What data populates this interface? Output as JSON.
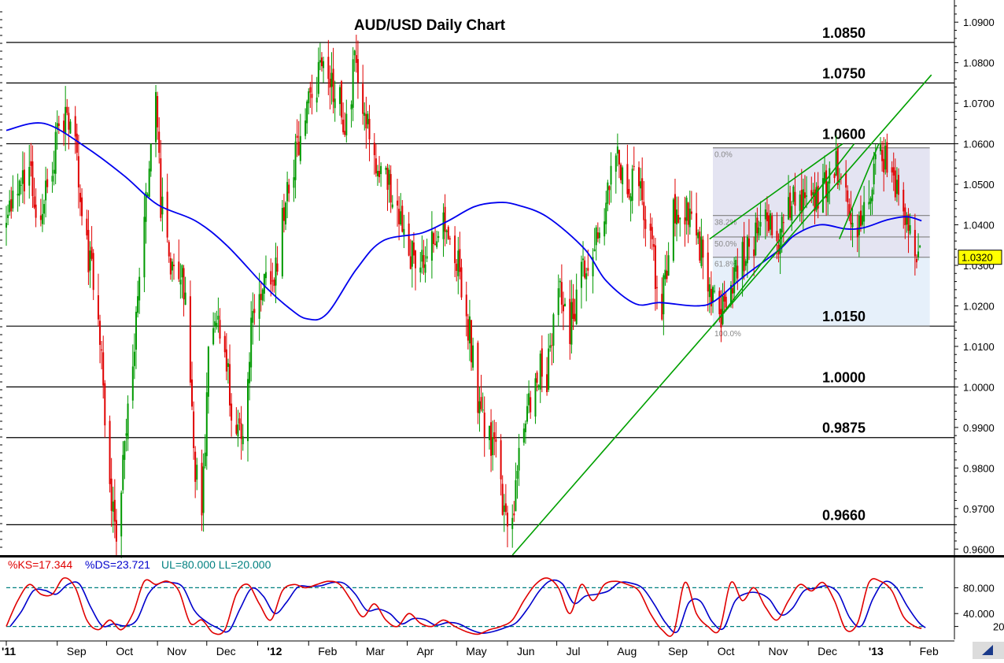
{
  "chart_data": {
    "type": "candlestick",
    "title": "AUD/USD Daily Chart",
    "instrument": "AUD/USD",
    "timeframe": "Daily",
    "price_axis": {
      "ylim": [
        0.9585,
        1.0945
      ],
      "ticks": [
        "0.9600",
        "0.9700",
        "0.9800",
        "0.9900",
        "1.0000",
        "1.0100",
        "1.0200",
        "1.0300",
        "1.0400",
        "1.0500",
        "1.0600",
        "1.0700",
        "1.0800",
        "1.0900"
      ],
      "current_price_label": "1.0320"
    },
    "x_axis": {
      "labels": [
        "'11",
        "Sep",
        "Oct",
        "Nov",
        "Dec",
        "'12",
        "Feb",
        "Mar",
        "Apr",
        "May",
        "Jun",
        "Jul",
        "Aug",
        "Sep",
        "Oct",
        "Nov",
        "Dec",
        "'13",
        "Feb"
      ],
      "range": [
        "2011-08-01",
        "2013-02-08"
      ]
    },
    "horizontal_levels": [
      {
        "value": 1.085,
        "label": "1.0850"
      },
      {
        "value": 1.075,
        "label": "1.0750"
      },
      {
        "value": 1.06,
        "label": "1.0600"
      },
      {
        "value": 1.015,
        "label": "1.0150"
      },
      {
        "value": 1.0,
        "label": "1.0000"
      },
      {
        "value": 0.9875,
        "label": "0.9875"
      },
      {
        "value": 0.966,
        "label": "0.9660"
      }
    ],
    "close_path": [
      [
        "2011-08-01",
        1.038
      ],
      [
        "2011-08-08",
        1.05
      ],
      [
        "2011-08-15",
        1.052
      ],
      [
        "2011-08-22",
        1.041
      ],
      [
        "2011-08-29",
        1.055
      ],
      [
        "2011-09-05",
        1.067
      ],
      [
        "2011-09-12",
        1.058
      ],
      [
        "2011-09-19",
        1.035
      ],
      [
        "2011-09-26",
        1.017
      ],
      [
        "2011-10-03",
        0.972
      ],
      [
        "2011-10-07",
        0.965
      ],
      [
        "2011-10-12",
        0.983
      ],
      [
        "2011-10-17",
        1.005
      ],
      [
        "2011-10-24",
        1.042
      ],
      [
        "2011-10-31",
        1.07
      ],
      [
        "2011-11-03",
        1.045
      ],
      [
        "2011-11-10",
        1.03
      ],
      [
        "2011-11-17",
        1.025
      ],
      [
        "2011-11-24",
        0.98
      ],
      [
        "2011-11-28",
        0.968
      ],
      [
        "2011-12-02",
        1.008
      ],
      [
        "2011-12-08",
        1.018
      ],
      [
        "2011-12-15",
        0.998
      ],
      [
        "2011-12-22",
        0.988
      ],
      [
        "2011-12-29",
        1.018
      ],
      [
        "2012-01-05",
        1.025
      ],
      [
        "2012-01-12",
        1.03
      ],
      [
        "2012-01-19",
        1.047
      ],
      [
        "2012-01-26",
        1.06
      ],
      [
        "2012-02-02",
        1.07
      ],
      [
        "2012-02-09",
        1.078
      ],
      [
        "2012-02-16",
        1.072
      ],
      [
        "2012-02-23",
        1.067
      ],
      [
        "2012-03-01",
        1.08
      ],
      [
        "2012-03-08",
        1.065
      ],
      [
        "2012-03-15",
        1.054
      ],
      [
        "2012-03-22",
        1.048
      ],
      [
        "2012-03-29",
        1.04
      ],
      [
        "2012-04-05",
        1.03
      ],
      [
        "2012-04-12",
        1.035
      ],
      [
        "2012-04-19",
        1.038
      ],
      [
        "2012-04-26",
        1.04
      ],
      [
        "2012-05-03",
        1.028
      ],
      [
        "2012-05-10",
        1.01
      ],
      [
        "2012-05-17",
        0.99
      ],
      [
        "2012-05-24",
        0.985
      ],
      [
        "2012-05-31",
        0.968
      ],
      [
        "2012-06-04",
        0.97
      ],
      [
        "2012-06-11",
        0.99
      ],
      [
        "2012-06-18",
        1.005
      ],
      [
        "2012-06-25",
        1.002
      ],
      [
        "2012-07-02",
        1.025
      ],
      [
        "2012-07-09",
        1.015
      ],
      [
        "2012-07-16",
        1.027
      ],
      [
        "2012-07-23",
        1.035
      ],
      [
        "2012-07-30",
        1.045
      ],
      [
        "2012-08-06",
        1.058
      ],
      [
        "2012-08-13",
        1.052
      ],
      [
        "2012-08-20",
        1.048
      ],
      [
        "2012-08-27",
        1.035
      ],
      [
        "2012-09-03",
        1.02
      ],
      [
        "2012-09-10",
        1.045
      ],
      [
        "2012-09-17",
        1.045
      ],
      [
        "2012-09-24",
        1.04
      ],
      [
        "2012-10-01",
        1.026
      ],
      [
        "2012-10-08",
        1.018
      ],
      [
        "2012-10-15",
        1.023
      ],
      [
        "2012-10-22",
        1.032
      ],
      [
        "2012-10-29",
        1.035
      ],
      [
        "2012-11-05",
        1.04
      ],
      [
        "2012-11-12",
        1.036
      ],
      [
        "2012-11-19",
        1.043
      ],
      [
        "2012-11-26",
        1.047
      ],
      [
        "2012-12-03",
        1.046
      ],
      [
        "2012-12-10",
        1.05
      ],
      [
        "2012-12-17",
        1.055
      ],
      [
        "2012-12-24",
        1.045
      ],
      [
        "2012-12-31",
        1.037
      ],
      [
        "2013-01-07",
        1.047
      ],
      [
        "2013-01-14",
        1.058
      ],
      [
        "2013-01-21",
        1.052
      ],
      [
        "2013-01-28",
        1.043
      ],
      [
        "2013-02-04",
        1.037
      ],
      [
        "2013-02-07",
        1.031
      ]
    ],
    "moving_average": [
      [
        "2011-08-01",
        1.0633
      ],
      [
        "2011-08-24",
        1.065
      ],
      [
        "2011-09-19",
        1.059
      ],
      [
        "2011-10-12",
        1.052
      ],
      [
        "2011-11-01",
        1.045
      ],
      [
        "2011-11-24",
        1.041
      ],
      [
        "2011-12-13",
        1.035
      ],
      [
        "2012-01-05",
        1.025
      ],
      [
        "2012-01-20",
        1.0195
      ],
      [
        "2012-01-31",
        1.0168
      ],
      [
        "2012-02-12",
        1.018
      ],
      [
        "2012-03-01",
        1.029
      ],
      [
        "2012-03-17",
        1.036
      ],
      [
        "2012-04-10",
        1.038
      ],
      [
        "2012-04-26",
        1.041
      ],
      [
        "2012-05-12",
        1.0445
      ],
      [
        "2012-05-26",
        1.0455
      ],
      [
        "2012-06-06",
        1.045
      ],
      [
        "2012-06-25",
        1.042
      ],
      [
        "2012-07-18",
        1.034
      ],
      [
        "2012-07-31",
        1.0262
      ],
      [
        "2012-08-18",
        1.0205
      ],
      [
        "2012-09-02",
        1.0208
      ],
      [
        "2012-09-24",
        1.02
      ],
      [
        "2012-10-05",
        1.0212
      ],
      [
        "2012-10-22",
        1.027
      ],
      [
        "2012-11-13",
        1.0337
      ],
      [
        "2012-11-23",
        1.0375
      ],
      [
        "2012-12-08",
        1.04
      ],
      [
        "2012-12-24",
        1.039
      ],
      [
        "2013-01-04",
        1.0393
      ],
      [
        "2013-01-18",
        1.0412
      ],
      [
        "2013-01-30",
        1.042
      ],
      [
        "2013-02-08",
        1.041
      ]
    ],
    "trendlines": [
      {
        "from": [
          "2012-06-04",
          0.9585
        ],
        "to": [
          "2013-02-14",
          1.077
        ]
      },
      {
        "from": [
          "2012-10-02",
          1.0365
        ],
        "to": [
          "2012-12-22",
          1.06
        ]
      },
      {
        "from": [
          "2012-10-04",
          1.015
        ],
        "to": [
          "2012-12-29",
          1.06
        ]
      },
      {
        "from": [
          "2012-12-20",
          1.0365
        ],
        "to": [
          "2013-01-13",
          1.06
        ]
      }
    ],
    "fibonacci": {
      "start_date": "2012-10-04",
      "end_date": "2013-02-13",
      "levels": [
        {
          "label": "0.0%",
          "value": 1.059
        },
        {
          "label": "38.2%",
          "value": 1.0423
        },
        {
          "label": "50.0%",
          "value": 1.037
        },
        {
          "label": "61.8%",
          "value": 1.032
        },
        {
          "label": "100.0%",
          "value": 1.015
        }
      ]
    },
    "stochastic": {
      "legend": [
        {
          "label": "%KS=17.344",
          "color": "#e00000"
        },
        {
          "label": "%DS=23.721",
          "color": "#0000cc"
        },
        {
          "label": "UL=80.000 LL=20.000",
          "color": "#008080"
        }
      ],
      "ylim": [
        0,
        100
      ],
      "ticks": [
        "20",
        "40.000",
        "80.000"
      ],
      "upper_level": 80,
      "lower_level": 20,
      "k_values": [
        [
          "2011-08-01",
          20
        ],
        [
          "2011-08-08",
          60
        ],
        [
          "2011-08-15",
          85
        ],
        [
          "2011-08-22",
          70
        ],
        [
          "2011-08-29",
          70
        ],
        [
          "2011-09-05",
          95
        ],
        [
          "2011-09-12",
          80
        ],
        [
          "2011-09-19",
          30
        ],
        [
          "2011-09-26",
          15
        ],
        [
          "2011-10-03",
          30
        ],
        [
          "2011-10-10",
          15
        ],
        [
          "2011-10-17",
          40
        ],
        [
          "2011-10-24",
          90
        ],
        [
          "2011-10-31",
          85
        ],
        [
          "2011-11-07",
          90
        ],
        [
          "2011-11-14",
          75
        ],
        [
          "2011-11-21",
          25
        ],
        [
          "2011-11-28",
          30
        ],
        [
          "2011-12-05",
          10
        ],
        [
          "2011-12-12",
          15
        ],
        [
          "2011-12-19",
          70
        ],
        [
          "2011-12-26",
          85
        ],
        [
          "2012-01-02",
          55
        ],
        [
          "2012-01-09",
          30
        ],
        [
          "2012-01-16",
          75
        ],
        [
          "2012-01-23",
          85
        ],
        [
          "2012-01-30",
          80
        ],
        [
          "2012-02-06",
          85
        ],
        [
          "2012-02-13",
          90
        ],
        [
          "2012-02-20",
          85
        ],
        [
          "2012-02-27",
          60
        ],
        [
          "2012-03-05",
          35
        ],
        [
          "2012-03-12",
          55
        ],
        [
          "2012-03-19",
          30
        ],
        [
          "2012-03-26",
          20
        ],
        [
          "2012-04-02",
          40
        ],
        [
          "2012-04-09",
          25
        ],
        [
          "2012-04-16",
          20
        ],
        [
          "2012-04-23",
          30
        ],
        [
          "2012-04-30",
          20
        ],
        [
          "2012-05-07",
          12
        ],
        [
          "2012-05-14",
          8
        ],
        [
          "2012-05-21",
          15
        ],
        [
          "2012-05-28",
          20
        ],
        [
          "2012-06-04",
          30
        ],
        [
          "2012-06-11",
          60
        ],
        [
          "2012-06-18",
          85
        ],
        [
          "2012-06-25",
          95
        ],
        [
          "2012-07-02",
          80
        ],
        [
          "2012-07-09",
          40
        ],
        [
          "2012-07-16",
          85
        ],
        [
          "2012-07-23",
          60
        ],
        [
          "2012-07-30",
          85
        ],
        [
          "2012-08-06",
          90
        ],
        [
          "2012-08-13",
          85
        ],
        [
          "2012-08-20",
          75
        ],
        [
          "2012-08-27",
          40
        ],
        [
          "2012-09-03",
          15
        ],
        [
          "2012-09-10",
          10
        ],
        [
          "2012-09-17",
          88
        ],
        [
          "2012-09-24",
          40
        ],
        [
          "2012-10-01",
          20
        ],
        [
          "2012-10-08",
          15
        ],
        [
          "2012-10-15",
          88
        ],
        [
          "2012-10-22",
          60
        ],
        [
          "2012-10-29",
          80
        ],
        [
          "2012-11-05",
          50
        ],
        [
          "2012-11-12",
          30
        ],
        [
          "2012-11-19",
          60
        ],
        [
          "2012-11-26",
          85
        ],
        [
          "2012-12-03",
          75
        ],
        [
          "2012-12-10",
          88
        ],
        [
          "2012-12-17",
          60
        ],
        [
          "2012-12-24",
          15
        ],
        [
          "2012-12-31",
          25
        ],
        [
          "2013-01-07",
          88
        ],
        [
          "2013-01-14",
          90
        ],
        [
          "2013-01-21",
          75
        ],
        [
          "2013-01-28",
          35
        ],
        [
          "2013-02-04",
          20
        ],
        [
          "2013-02-08",
          17
        ]
      ]
    },
    "grid": false
  },
  "ui": {
    "corner_icon": "triangle-arrow-icon",
    "colors": {
      "up_candle": "#009900",
      "down_candle": "#e00000",
      "moving_average": "#0000ee",
      "trendline": "#00a000",
      "fib_zone": "#e4e4f2",
      "fib_zone_lower": "#e6f0fa",
      "price_tag": "#ffff00",
      "stoch_k": "#e00000",
      "stoch_d": "#0000cc",
      "stoch_levels": "#008080"
    }
  }
}
